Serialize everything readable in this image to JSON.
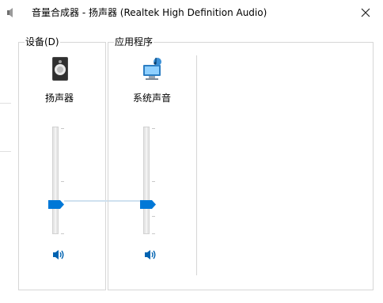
{
  "window": {
    "title": "音量合成器 - 扬声器 (Realtek High Definition Audio)"
  },
  "device_group": {
    "label": "设备(D)",
    "channel": {
      "name": "扬声器",
      "level": 0.31
    }
  },
  "apps_group": {
    "label": "应用程序",
    "channels": [
      {
        "name": "系统声音",
        "level": 0.31
      }
    ]
  },
  "colors": {
    "accent": "#0078d7",
    "border": "#d6d6d6"
  },
  "icons": {
    "title": "speaker-icon",
    "close": "close-icon",
    "device": "speaker-device-icon",
    "system_sounds": "system-sounds-icon",
    "mute": "volume-icon"
  }
}
